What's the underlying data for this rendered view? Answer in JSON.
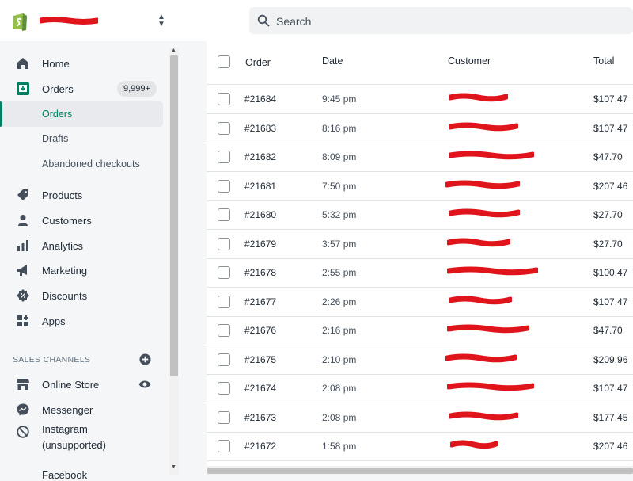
{
  "search": {
    "placeholder": "Search"
  },
  "sidebar": {
    "items": [
      {
        "label": "Home",
        "icon": "home-icon"
      },
      {
        "label": "Orders",
        "icon": "orders-icon",
        "badge": "9,999+"
      },
      {
        "label": "Products",
        "icon": "products-tag-icon"
      },
      {
        "label": "Customers",
        "icon": "customers-icon"
      },
      {
        "label": "Analytics",
        "icon": "analytics-icon"
      },
      {
        "label": "Marketing",
        "icon": "marketing-megaphone-icon"
      },
      {
        "label": "Discounts",
        "icon": "discounts-icon"
      },
      {
        "label": "Apps",
        "icon": "apps-icon"
      }
    ],
    "orders_sub": [
      {
        "label": "Orders",
        "active": true
      },
      {
        "label": "Drafts"
      },
      {
        "label": "Abandoned checkouts"
      }
    ],
    "sales_channels_heading": "SALES CHANNELS",
    "channels": [
      {
        "label": "Online Store",
        "icon": "store-icon"
      },
      {
        "label": "Messenger",
        "icon": "messenger-icon"
      },
      {
        "label": "Instagram",
        "sublabel": "(unsupported)",
        "icon": "instagram-blocked-icon"
      }
    ],
    "partial_item": "Facebook"
  },
  "table": {
    "headers": {
      "order": "Order",
      "date": "Date",
      "customer": "Customer",
      "total": "Total"
    },
    "rows": [
      {
        "order": "#21684",
        "date": "9:45 pm",
        "total": "$107.47"
      },
      {
        "order": "#21683",
        "date": "8:16 pm",
        "total": "$107.47"
      },
      {
        "order": "#21682",
        "date": "8:09 pm",
        "total": "$47.70"
      },
      {
        "order": "#21681",
        "date": "7:50 pm",
        "total": "$207.46"
      },
      {
        "order": "#21680",
        "date": "5:32 pm",
        "total": "$27.70"
      },
      {
        "order": "#21679",
        "date": "3:57 pm",
        "total": "$27.70"
      },
      {
        "order": "#21678",
        "date": "2:55 pm",
        "total": "$100.47"
      },
      {
        "order": "#21677",
        "date": "2:26 pm",
        "total": "$107.47"
      },
      {
        "order": "#21676",
        "date": "2:16 pm",
        "total": "$47.70"
      },
      {
        "order": "#21675",
        "date": "2:10 pm",
        "total": "$209.96"
      },
      {
        "order": "#21674",
        "date": "2:08 pm",
        "total": "$107.47"
      },
      {
        "order": "#21673",
        "date": "2:08 pm",
        "total": "$177.45"
      },
      {
        "order": "#21672",
        "date": "1:58 pm",
        "total": "$207.46"
      }
    ]
  },
  "colors": {
    "brand": "#008060",
    "redaction": "#e0141b",
    "logo_green": "#95bf47"
  }
}
